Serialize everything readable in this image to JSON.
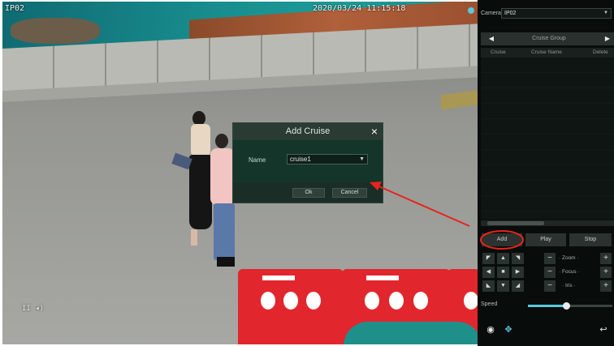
{
  "video": {
    "camera_name": "IP02",
    "timestamp": "2020/03/24 11:15:18",
    "mini_osd": "II ◂)"
  },
  "dialog": {
    "title": "Add Cruise",
    "close_icon": "×",
    "name_label": "Name",
    "name_value": "cruise1",
    "ok_label": "Ok",
    "cancel_label": "Cancel"
  },
  "panel": {
    "camera_label": "Camera",
    "camera_value": "IP02",
    "group_title": "Cruise Group",
    "columns": {
      "cruise": "Cruise",
      "name": "Cruise Name",
      "delete": "Delete"
    },
    "add_label": "Add",
    "play_label": "Play",
    "stop_label": "Stop",
    "zoom_label": "Zoom",
    "focus_label": "Focus",
    "iris_label": "Iris",
    "speed_label": "Speed",
    "speed_level": 0.45
  },
  "colors": {
    "accent": "#58c8e0",
    "annotation": "#e8231c"
  }
}
